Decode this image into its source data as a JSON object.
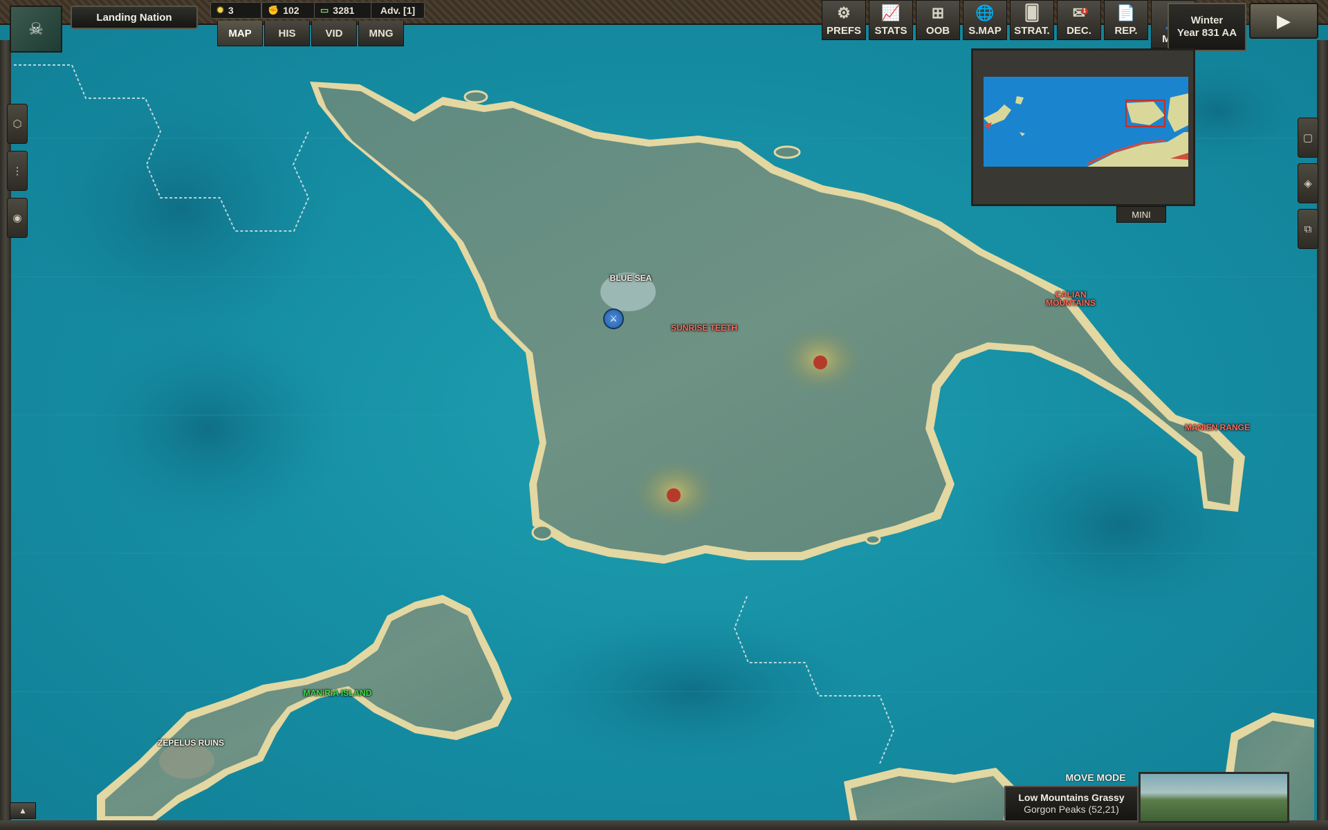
{
  "header": {
    "nation_name": "Landing Nation",
    "resources": [
      {
        "icon": "sun-icon",
        "value": "3"
      },
      {
        "icon": "fist-icon",
        "value": "102"
      },
      {
        "icon": "money-icon",
        "value": "3281"
      }
    ],
    "advisor": "Adv. [1]"
  },
  "tabs": [
    "MAP",
    "HIS",
    "VID",
    "MNG"
  ],
  "toolbar": [
    {
      "label": "PREFS",
      "icon": "gear-icon"
    },
    {
      "label": "STATS",
      "icon": "chart-icon"
    },
    {
      "label": "OOB",
      "icon": "hierarchy-icon"
    },
    {
      "label": "S.MAP",
      "icon": "globe-icon"
    },
    {
      "label": "STRAT.",
      "icon": "cards-icon"
    },
    {
      "label": "DEC.",
      "icon": "envelope-icon",
      "badge": "1"
    },
    {
      "label": "REP.",
      "icon": "report-icon"
    },
    {
      "label": "MINI",
      "icon": "minimap-icon"
    }
  ],
  "turn": {
    "season": "Winter",
    "year": "Year 831 AA"
  },
  "minimap": {
    "tab_label": "MINI"
  },
  "map_labels": {
    "blue_sea": "BLUE SEA",
    "sunrise_teeth": "SUNRISE TEETH",
    "calian_mountains": "CALIAN MOUNTAINS",
    "manien_range": "MANIEN RANGE",
    "maniria_island": "MANIRIA ISLAND",
    "zepelus_ruins": "ZEPELUS RUINS"
  },
  "status": {
    "mode": "MOVE MODE",
    "terrain": "Low Mountains Grassy",
    "location": "Gorgon Peaks (52,21)"
  }
}
